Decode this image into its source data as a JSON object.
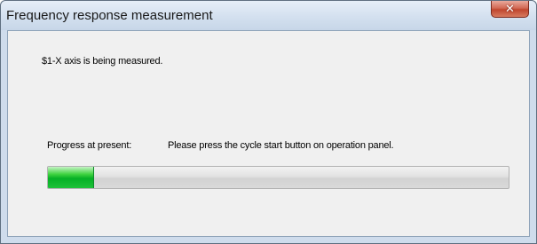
{
  "window": {
    "title": "Frequency response measurement",
    "close_icon": "close-icon"
  },
  "content": {
    "message": "$1-X axis is being measured.",
    "progress_label": "Progress at present:",
    "status_text": "Please press the cycle start button on operation panel."
  },
  "progress": {
    "fraction": 0.1
  },
  "colors": {
    "progress_fill": "#06b025",
    "close_button": "#c75050"
  }
}
